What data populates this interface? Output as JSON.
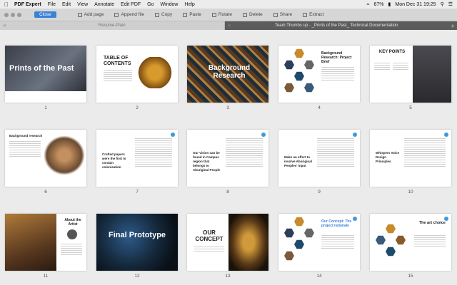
{
  "menubar": {
    "app_name": "PDF Expert",
    "items": [
      "File",
      "Edit",
      "View",
      "Annotate",
      "Edit PDF",
      "Go",
      "Window",
      "Help"
    ],
    "battery": "67%",
    "clock": "Mon Dec 31 19:25"
  },
  "toolbar": {
    "close_label": "Close",
    "tools": [
      "Add page",
      "Append file",
      "Copy",
      "Paste",
      "Rotate",
      "Delete",
      "Share",
      "Extract"
    ]
  },
  "tabs": [
    {
      "label": "Resume-Plain",
      "active": false
    },
    {
      "label": "Team Thumbs up - _Prints of the Past_ Technical Documentation",
      "active": true
    }
  ],
  "pages": [
    {
      "num": "1",
      "title": "Prints of the Past"
    },
    {
      "num": "2",
      "title": "TABLE OF CONTENTS"
    },
    {
      "num": "3",
      "title": "Background Research"
    },
    {
      "num": "4",
      "title": "Background Research: Project Brief"
    },
    {
      "num": "5",
      "title": "KEY POINTS"
    },
    {
      "num": "6",
      "title": "Background research"
    },
    {
      "num": "7",
      "title": "Crafted papers were the first to contain colonisation"
    },
    {
      "num": "8",
      "title": "Our vision can be found in Campus region that belongs to Aboriginal People"
    },
    {
      "num": "9",
      "title": "Make an effort to involve Aboriginal Peoples' input"
    },
    {
      "num": "10",
      "title": "Whispers Voice Design Principles"
    },
    {
      "num": "11",
      "title": "About the Artist"
    },
    {
      "num": "12",
      "title": "Final Prototype"
    },
    {
      "num": "13",
      "title": "OUR CONCEPT"
    },
    {
      "num": "14",
      "title": "Our Concept: The project rationale"
    },
    {
      "num": "15",
      "title": "The art choice"
    }
  ],
  "colors": {
    "accent": "#3b82d6",
    "badge": "#3b9be0",
    "tab_active": "#5c5c5c"
  }
}
